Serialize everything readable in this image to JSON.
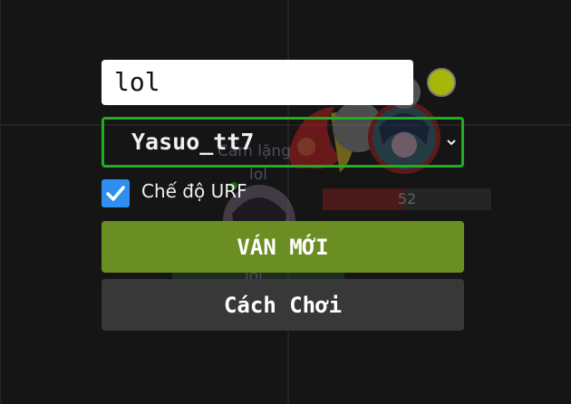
{
  "colors": {
    "background": "#151515",
    "player_color": "#a8b50b",
    "select_border": "#1fae1f",
    "checkbox": "#2f8ff0",
    "new_game_button": "#6b8e23",
    "howto_button": "#383838"
  },
  "menu": {
    "name_input": {
      "value": "lol",
      "placeholder": ""
    },
    "champion_select": {
      "selected": "Yasuo_tt7",
      "icon": "chevron-down-icon"
    },
    "urf_mode": {
      "label": "Chế độ URF",
      "checked": true,
      "icon": "check-icon"
    },
    "new_game_label": "VÁN MỚI",
    "how_to_play_label": "Cách Chơi"
  },
  "scene": {
    "enemy_name": "Cấm lặng",
    "player_name_1": "lol",
    "player_name_2": "lol",
    "hp_value": "52",
    "hp_fraction": 0.48
  }
}
